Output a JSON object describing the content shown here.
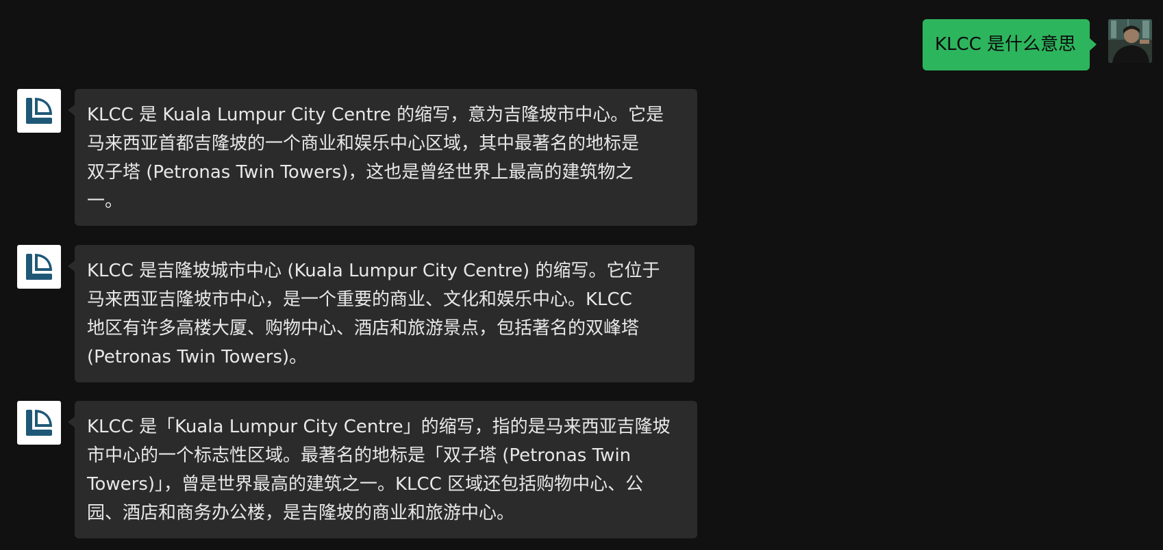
{
  "user_message": {
    "text": "KLCC 是什么意思"
  },
  "bot_messages": [
    {
      "text": "KLCC 是 Kuala Lumpur City Centre 的缩写，意为吉隆坡市中心。它是\n马来西亚首都吉隆坡的一个商业和娱乐中心区域，其中最著名的地标是\n双子塔 (Petronas Twin Towers)，这也是曾经世界上最高的建筑物之\n一。"
    },
    {
      "text": "KLCC 是吉隆坡城市中心 (Kuala Lumpur City Centre) 的缩写。它位于\n马来西亚吉隆坡市中心，是一个重要的商业、文化和娱乐中心。KLCC\n地区有许多高楼大厦、购物中心、酒店和旅游景点，包括著名的双峰塔\n(Petronas Twin Towers)。"
    },
    {
      "text": "KLCC 是「Kuala Lumpur City Centre」的缩写，指的是马来西亚吉隆坡\n市中心的一个标志性区域。最著名的地标是「双子塔 (Petronas Twin\nTowers)」，曾是世界最高的建筑之一。KLCC 区域还包括购物中心、公\n园、酒店和商务办公楼，是吉隆坡的商业和旅游中心。"
    }
  ],
  "colors": {
    "background": "#111111",
    "user_bubble": "#2db55d",
    "bot_bubble": "#2b2b2b",
    "bot_text": "#e8e8e8",
    "logo": "#1f5876"
  },
  "icons": {
    "bot_avatar": "app-logo-icon",
    "user_avatar": "user-photo"
  }
}
